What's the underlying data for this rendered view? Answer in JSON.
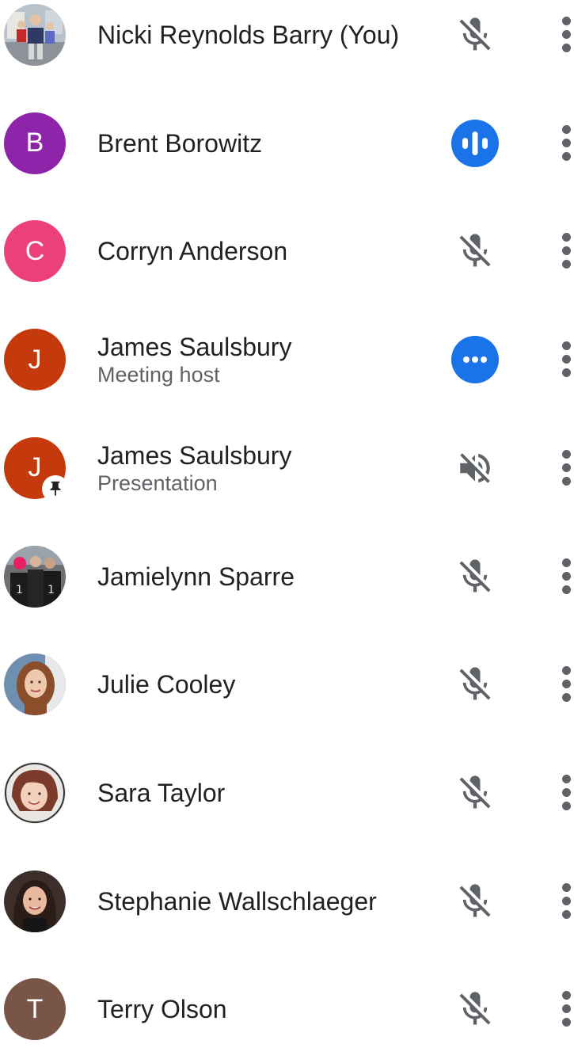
{
  "participants": [
    {
      "name": "Nicki Reynolds Barry (You)",
      "subtitle": "",
      "avatar": {
        "type": "photo",
        "photo": "kids-photo"
      },
      "status": "mic-off-icon"
    },
    {
      "name": "Brent Borowitz",
      "subtitle": "",
      "avatar": {
        "type": "letter",
        "letter": "B",
        "color": "#8e24aa"
      },
      "status": "speaking-icon"
    },
    {
      "name": "Corryn Anderson",
      "subtitle": "",
      "avatar": {
        "type": "letter",
        "letter": "C",
        "color": "#ec407a"
      },
      "status": "mic-off-icon"
    },
    {
      "name": "James Saulsbury",
      "subtitle": "Meeting host",
      "avatar": {
        "type": "letter",
        "letter": "J",
        "color": "#c53a0c"
      },
      "status": "more-horiz-icon"
    },
    {
      "name": "James Saulsbury",
      "subtitle": "Presentation",
      "avatar": {
        "type": "letter",
        "letter": "J",
        "color": "#c53a0c",
        "badge": "pin-icon"
      },
      "status": "volume-off-icon"
    },
    {
      "name": "Jamielynn Sparre",
      "subtitle": "",
      "avatar": {
        "type": "photo",
        "photo": "team-photo"
      },
      "status": "mic-off-icon"
    },
    {
      "name": "Julie Cooley",
      "subtitle": "",
      "avatar": {
        "type": "photo",
        "photo": "woman-auburn-photo"
      },
      "status": "mic-off-icon"
    },
    {
      "name": "Sara Taylor",
      "subtitle": "",
      "avatar": {
        "type": "photo",
        "photo": "woman-red-hair-photo"
      },
      "status": "mic-off-icon"
    },
    {
      "name": "Stephanie Wallschlaeger",
      "subtitle": "",
      "avatar": {
        "type": "photo",
        "photo": "woman-dark-hair-photo"
      },
      "status": "mic-off-icon"
    },
    {
      "name": "Terry Olson",
      "subtitle": "",
      "avatar": {
        "type": "letter",
        "letter": "T",
        "color": "#795548"
      },
      "status": "mic-off-icon"
    }
  ],
  "colors": {
    "accent_blue": "#1a73e8",
    "icon_gray": "#5f6368",
    "text_primary": "#202124",
    "text_secondary": "#5f6368"
  }
}
